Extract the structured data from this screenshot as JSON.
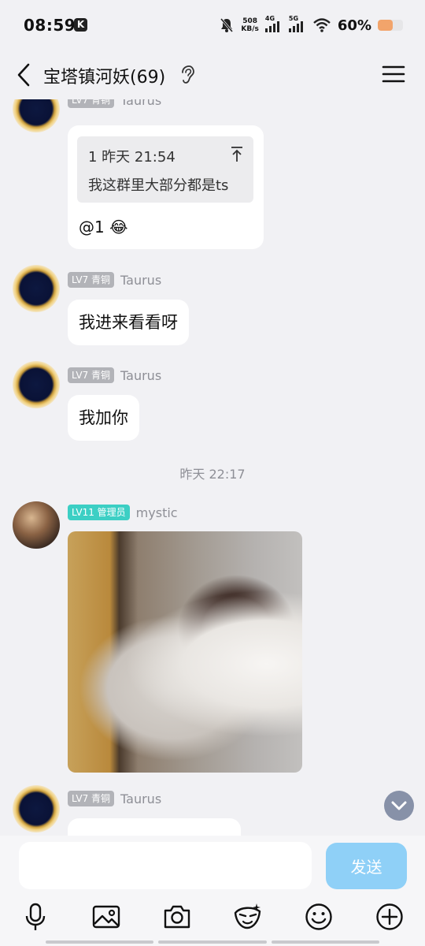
{
  "status_bar": {
    "time": "08:59",
    "app_badge": "K",
    "net_speed_value": "508",
    "net_speed_unit": "KB/s",
    "signal_1_label": "4G",
    "signal_2_label": "5G",
    "battery_percent": "60%",
    "battery_level": 0.6
  },
  "header": {
    "title": "宝塔镇河妖(69)"
  },
  "messages": [
    {
      "level": "LV7 青铜",
      "nickname": "Taurus",
      "quote_head": "1 昨天 21:54",
      "quote_text": "我这群里大部分都是ts",
      "reply": "@1 😂"
    },
    {
      "level": "LV7 青铜",
      "nickname": "Taurus",
      "text": "我进来看看呀"
    },
    {
      "level": "LV7 青铜",
      "nickname": "Taurus",
      "text": "我加你"
    },
    {
      "time_divider": "昨天 22:17"
    },
    {
      "level": "LV11 管理员",
      "nickname": "mystic"
    },
    {
      "level": "LV7 青铜",
      "nickname": "Taurus"
    }
  ],
  "input": {
    "placeholder": "",
    "send_label": "发送"
  },
  "toolbar_icons": [
    "microphone-icon",
    "image-icon",
    "camera-icon",
    "sticker-icon",
    "emoji-icon",
    "plus-icon"
  ],
  "colors": {
    "background": "#f1f1f4",
    "send_button": "#8fd0f7",
    "admin_badge": "#3ccfc4",
    "level_badge": "#b2b3b8",
    "battery_fill": "#f2a46b"
  }
}
